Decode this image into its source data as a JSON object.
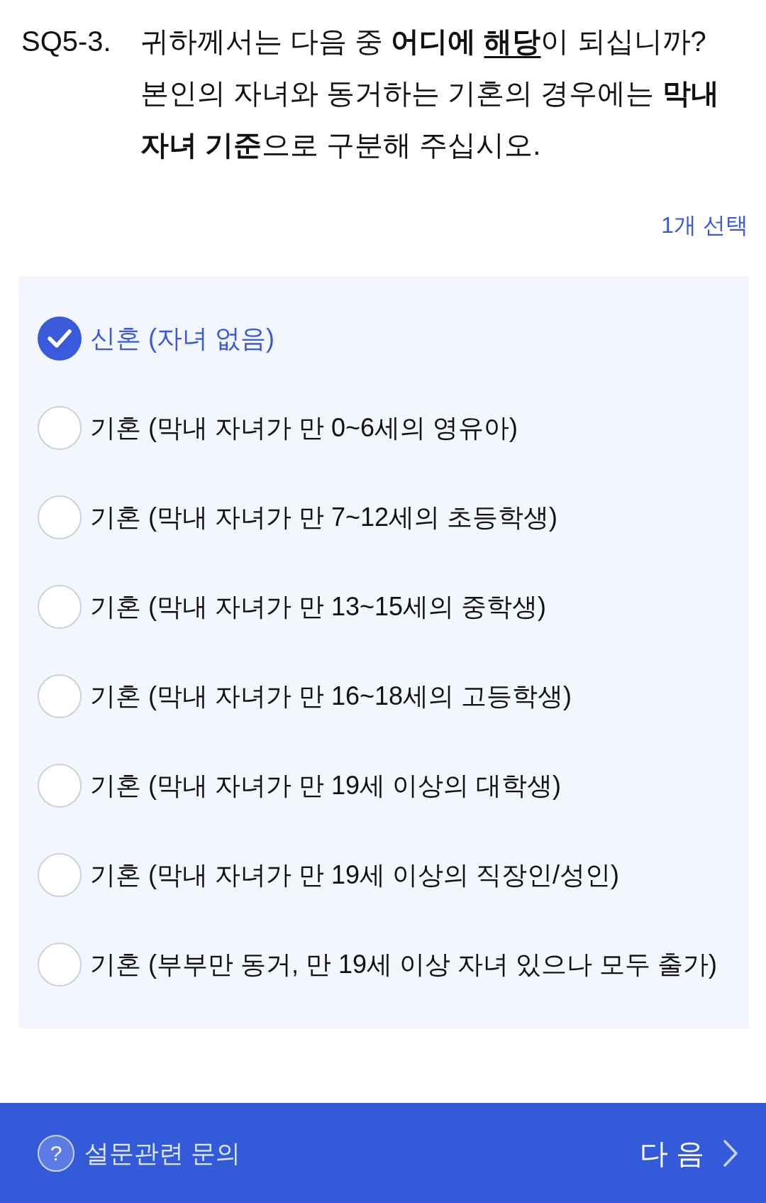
{
  "question": {
    "number": "SQ5-3.",
    "segments": [
      {
        "text": "귀하께서는 다음 중 ",
        "bold": false,
        "underline": false
      },
      {
        "text": "어디에 ",
        "bold": true,
        "underline": false
      },
      {
        "text": "해당",
        "bold": true,
        "underline": true
      },
      {
        "text": "이 되십니까? 본인의 자녀와 동거하는 기혼의 경우에는 ",
        "bold": false,
        "underline": false
      },
      {
        "text": "막내 자녀 기준",
        "bold": true,
        "underline": false
      },
      {
        "text": "으로 구분해 주십시오.",
        "bold": false,
        "underline": false
      }
    ]
  },
  "selection_count": "1개 선택",
  "options": [
    {
      "label": "신혼 (자녀 없음)",
      "selected": true
    },
    {
      "label": "기혼 (막내 자녀가 만 0~6세의 영유아)",
      "selected": false
    },
    {
      "label": "기혼 (막내 자녀가 만 7~12세의 초등학생)",
      "selected": false
    },
    {
      "label": "기혼 (막내 자녀가 만 13~15세의 중학생)",
      "selected": false
    },
    {
      "label": "기혼 (막내 자녀가 만 16~18세의 고등학생)",
      "selected": false
    },
    {
      "label": "기혼 (막내 자녀가 만 19세 이상의 대학생)",
      "selected": false
    },
    {
      "label": "기혼 (막내 자녀가 만 19세 이상의 직장인/성인)",
      "selected": false
    },
    {
      "label": "기혼 (부부만 동거, 만 19세 이상 자녀 있으나 모두 출가)",
      "selected": false
    }
  ],
  "footer": {
    "help_icon": "?",
    "help_label": "설문관련 문의",
    "next_label": "다 음"
  }
}
